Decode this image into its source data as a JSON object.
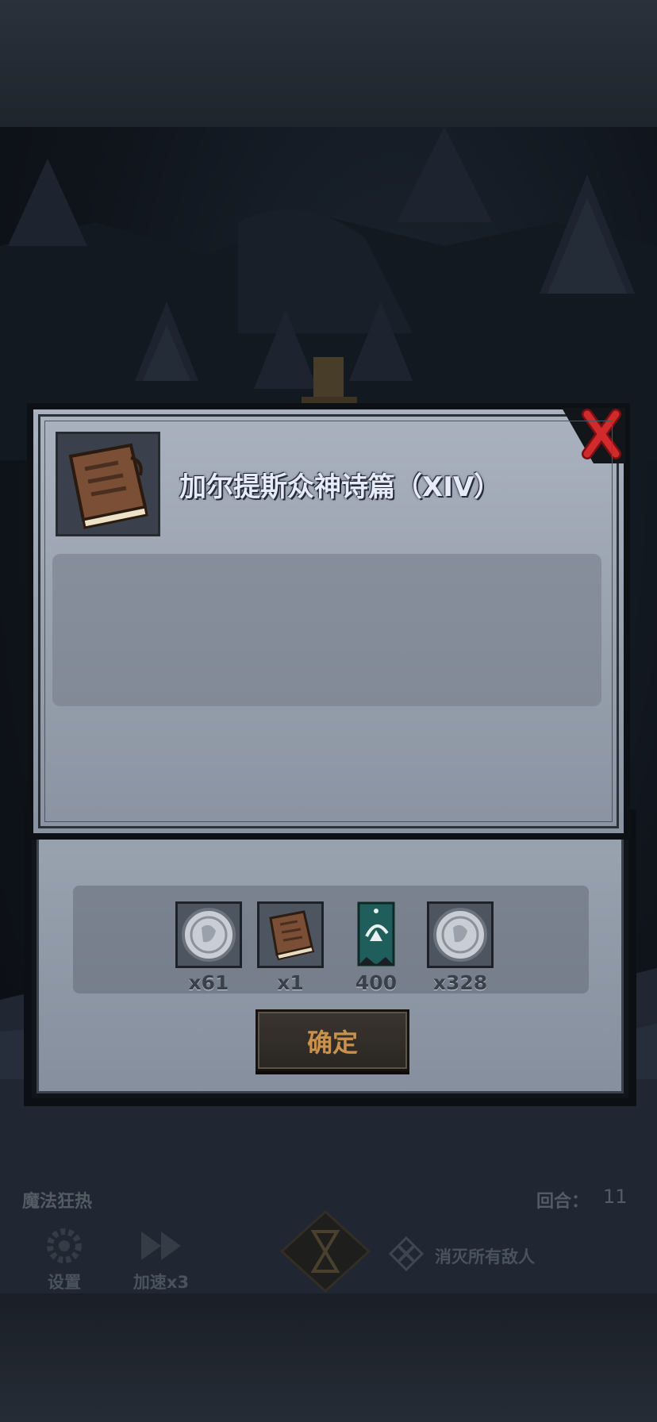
{
  "hud": {
    "mode_label": "魔法狂热",
    "round_label": "回合：",
    "round_value": "11",
    "settings_label": "设置",
    "speed_label": "加速x3",
    "objective_label": "消灭所有敌人"
  },
  "item_dialog": {
    "title": "加尔提斯众神诗篇（XIV）",
    "icon": "book-icon",
    "close_icon": "close-icon"
  },
  "reward_dialog": {
    "confirm_label": "确定",
    "rewards": [
      {
        "icon": "silver-coin-icon",
        "count": "x61"
      },
      {
        "icon": "book-icon",
        "count": "x1"
      },
      {
        "icon": "banner-icon",
        "count": "400"
      },
      {
        "icon": "silver-coin-icon",
        "count": "x328"
      }
    ]
  },
  "colors": {
    "dialog_bg": "#9aa3b0",
    "close_red": "#c8262a",
    "confirm_text": "#c9914b",
    "title_text": "#e6ecf7"
  }
}
